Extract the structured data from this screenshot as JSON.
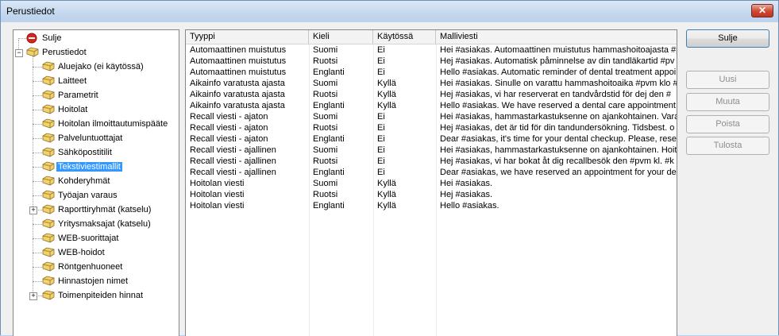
{
  "window": {
    "title": "Perustiedot",
    "close_glyph": "✕"
  },
  "tree": {
    "items": [
      {
        "label": "Sulje",
        "icon": "stop-icon"
      },
      {
        "label": "Perustiedot",
        "icon": "folder-icon"
      },
      {
        "label": "Aluejako (ei käytössä)",
        "icon": "folder-icon"
      },
      {
        "label": "Laitteet",
        "icon": "folder-icon"
      },
      {
        "label": "Parametrit",
        "icon": "folder-icon"
      },
      {
        "label": "Hoitolat",
        "icon": "folder-icon"
      },
      {
        "label": "Hoitolan ilmoittautumispääte",
        "icon": "folder-icon"
      },
      {
        "label": "Palveluntuottajat",
        "icon": "folder-icon"
      },
      {
        "label": "Sähköpostitilit",
        "icon": "folder-icon"
      },
      {
        "label": "Tekstiviestimallit",
        "icon": "folder-icon",
        "selected": true
      },
      {
        "label": "Kohderyhmät",
        "icon": "folder-icon"
      },
      {
        "label": "Työajan varaus",
        "icon": "folder-icon"
      },
      {
        "label": "Raporttiryhmät (katselu)",
        "icon": "folder-icon",
        "expander": "+"
      },
      {
        "label": "Yritysmaksajat (katselu)",
        "icon": "folder-icon"
      },
      {
        "label": "WEB-suorittajat",
        "icon": "folder-icon"
      },
      {
        "label": "WEB-hoidot",
        "icon": "folder-icon"
      },
      {
        "label": "Röntgenhuoneet",
        "icon": "folder-icon"
      },
      {
        "label": "Hinnastojen nimet",
        "icon": "folder-icon"
      },
      {
        "label": "Toimenpiteiden hinnat",
        "icon": "folder-icon",
        "expander": "+"
      }
    ],
    "root_expander": "−"
  },
  "grid": {
    "columns": [
      "Tyyppi",
      "Kieli",
      "Käytössä",
      "Malliviesti"
    ],
    "rows": [
      [
        "Automaattinen muistutus",
        "Suomi",
        "Ei",
        "Hei #asiakas. Automaattinen muistutus hammashoitoajasta #p"
      ],
      [
        "Automaattinen muistutus",
        "Ruotsi",
        "Ei",
        "Hej #asiakas. Automatisk påminnelse av din tandläkartid #pv"
      ],
      [
        "Automaattinen muistutus",
        "Englanti",
        "Ei",
        "Hello #asiakas. Automatic reminder of dental treatment appoi"
      ],
      [
        "Aikainfo varatusta ajasta",
        "Suomi",
        "Kyllä",
        "Hei #asiakas. Sinulle on varattu hammashoitoaika #pvm klo #"
      ],
      [
        "Aikainfo varatusta ajasta",
        "Ruotsi",
        "Kyllä",
        "Hej #asiakas, vi har reserverat en tandvårdstid för dej den #"
      ],
      [
        "Aikainfo varatusta ajasta",
        "Englanti",
        "Kyllä",
        "Hello #asiakas. We have reserved a dental care appointment"
      ],
      [
        "Recall viesti - ajaton",
        "Suomi",
        "Ei",
        "Hei #asiakas, hammastarkastuksenne on ajankohtainen. Vara"
      ],
      [
        "Recall viesti - ajaton",
        "Ruotsi",
        "Ei",
        "Hej #asiakas, det är tid för din tandundersökning. Tidsbest. o"
      ],
      [
        "Recall viesti - ajaton",
        "Englanti",
        "Ei",
        "Dear #asiakas, it's time for your dental checkup. Please, reser"
      ],
      [
        "Recall viesti - ajallinen",
        "Suomi",
        "Ei",
        "Hei #asiakas, hammastarkastuksenne on ajankohtainen. Hoito"
      ],
      [
        "Recall viesti - ajallinen",
        "Ruotsi",
        "Ei",
        "Hej #asiakas, vi har bokat åt dig recallbesök den #pvm kl. #k"
      ],
      [
        "Recall viesti - ajallinen",
        "Englanti",
        "Ei",
        "Dear #asiakas, we have reserved an appointment for your de"
      ],
      [
        "Hoitolan viesti",
        "Suomi",
        "Kyllä",
        "Hei #asiakas."
      ],
      [
        "Hoitolan viesti",
        "Ruotsi",
        "Kyllä",
        "Hej #asiakas."
      ],
      [
        "Hoitolan viesti",
        "Englanti",
        "Kyllä",
        "Hello #asiakas."
      ]
    ]
  },
  "buttons": {
    "close": "Sulje",
    "new": "Uusi",
    "edit": "Muuta",
    "delete": "Poista",
    "print": "Tulosta"
  },
  "colors": {
    "selection": "#3399ff",
    "stop_red": "#d9261c",
    "folder_yellow": "#f2d36b"
  }
}
